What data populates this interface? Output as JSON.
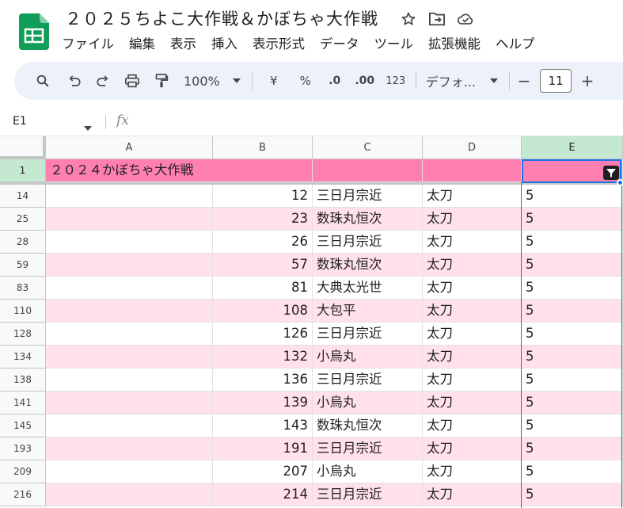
{
  "app": {
    "doc_title": "２０２５ちよこ大作戦＆かぼちゃ大作戦",
    "icons": [
      "star-icon",
      "move-to-folder-icon",
      "cloud-status-icon"
    ]
  },
  "menu": [
    "ファイル",
    "編集",
    "表示",
    "挿入",
    "表示形式",
    "データ",
    "ツール",
    "拡張機能",
    "ヘルプ"
  ],
  "toolbar": {
    "zoom": "100%",
    "currency": "¥",
    "percent": "%",
    "decrease_decimal": ".0",
    "increase_decimal": ".00",
    "number_format": "123",
    "font_name": "デフォ...",
    "font_size": "11",
    "minus": "−",
    "plus": "+"
  },
  "formula_bar": {
    "name_box": "E1",
    "fx_label": "fx",
    "value": ""
  },
  "columns": [
    "A",
    "B",
    "C",
    "D",
    "E"
  ],
  "selected_column": "E",
  "header_row": {
    "row_number": "1",
    "a": "２０２４かぼちゃ大作戦",
    "b": "",
    "c": "",
    "d": "",
    "e": ""
  },
  "rows": [
    {
      "row": "14",
      "b": "12",
      "c": "三日月宗近",
      "d": "太刀",
      "e": "5"
    },
    {
      "row": "25",
      "b": "23",
      "c": "数珠丸恒次",
      "d": "太刀",
      "e": "5"
    },
    {
      "row": "28",
      "b": "26",
      "c": "三日月宗近",
      "d": "太刀",
      "e": "5"
    },
    {
      "row": "59",
      "b": "57",
      "c": "数珠丸恒次",
      "d": "太刀",
      "e": "5"
    },
    {
      "row": "83",
      "b": "81",
      "c": "大典太光世",
      "d": "太刀",
      "e": "5"
    },
    {
      "row": "110",
      "b": "108",
      "c": "大包平",
      "d": "太刀",
      "e": "5"
    },
    {
      "row": "128",
      "b": "126",
      "c": "三日月宗近",
      "d": "太刀",
      "e": "5"
    },
    {
      "row": "134",
      "b": "132",
      "c": "小烏丸",
      "d": "太刀",
      "e": "5"
    },
    {
      "row": "138",
      "b": "136",
      "c": "三日月宗近",
      "d": "太刀",
      "e": "5"
    },
    {
      "row": "141",
      "b": "139",
      "c": "小烏丸",
      "d": "太刀",
      "e": "5"
    },
    {
      "row": "145",
      "b": "143",
      "c": "数珠丸恒次",
      "d": "太刀",
      "e": "5"
    },
    {
      "row": "193",
      "b": "191",
      "c": "三日月宗近",
      "d": "太刀",
      "e": "5"
    },
    {
      "row": "209",
      "b": "207",
      "c": "小烏丸",
      "d": "太刀",
      "e": "5"
    },
    {
      "row": "216",
      "b": "214",
      "c": "三日月宗近",
      "d": "太刀",
      "e": "5"
    }
  ],
  "colors": {
    "header_fill": "#ff80b0",
    "band_fill": "#ffe0ec",
    "selection": "#1a73e8",
    "sheets_green": "#0f9d58"
  }
}
